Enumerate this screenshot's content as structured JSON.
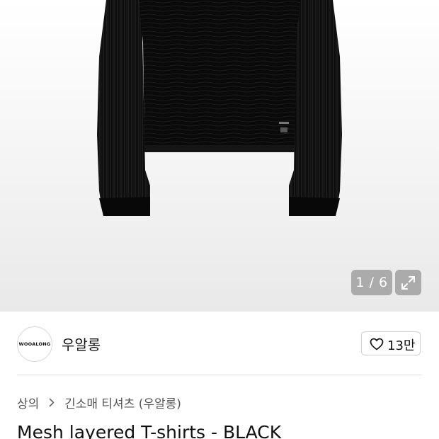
{
  "gallery": {
    "counter": "1 / 6",
    "image_label": "Mesh layered T-shirts - BLACK product photo"
  },
  "brand": {
    "logo_text": "WOOALONG",
    "name": "우알롱",
    "like_count": "13만"
  },
  "breadcrumb": {
    "category": "상의",
    "subcategory": "긴소매 티셔츠 (우알롱)"
  },
  "product": {
    "title": "Mesh layered T-shirts - BLACK"
  },
  "colors": {
    "accent": "#111111",
    "overlay_button": "#969696"
  }
}
